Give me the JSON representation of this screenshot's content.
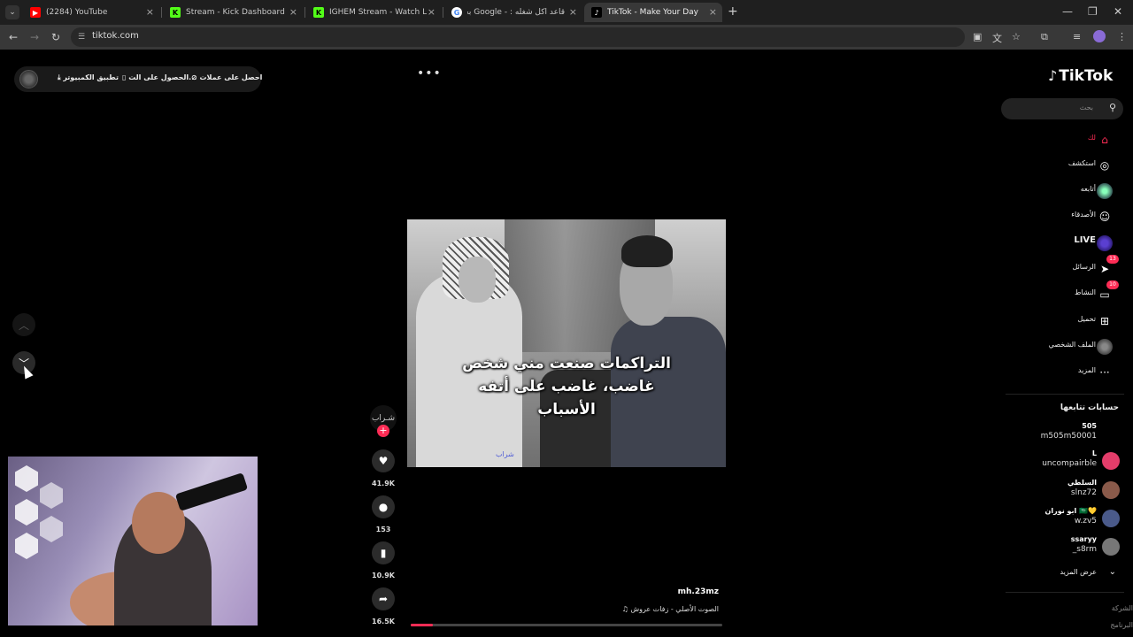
{
  "browser": {
    "tabs": [
      {
        "title": "(2284) YouTube",
        "favicon": "youtube-icon",
        "color": "#ff0000",
        "glyph": "▶"
      },
      {
        "title": "Stream - Kick Dashboard",
        "favicon": "kick-icon",
        "color": "#53fc18",
        "glyph": "K"
      },
      {
        "title": "IGHEM Stream - Watch Live on",
        "favicon": "kick-icon",
        "color": "#53fc18",
        "glyph": "K"
      },
      {
        "title": "قاعد اكل شغله : - Google بحث",
        "favicon": "google-icon",
        "color": "#ffffff",
        "glyph": "G"
      },
      {
        "title": "TikTok - Make Your Day",
        "favicon": "tiktok-icon",
        "color": "#000000",
        "glyph": "♪"
      }
    ],
    "active_tab": 4,
    "url": "tiktok.com"
  },
  "top_pill": {
    "get_coins": "احصل على عملات",
    "get_app": "الحصول على الت...",
    "desktop_app": "تطبيق الكمبيوتر"
  },
  "video": {
    "subtitle_lines": [
      "التراكمات صنعت مني شخص",
      "غاضب، غاضب على أتفه",
      "الأسباب"
    ],
    "watermark": "شراب",
    "creator_avatar_text": "شـراب",
    "handle": "mh.23mz",
    "music": "♫ الصوت الأصلي - زفات عروش",
    "progress": 0.07
  },
  "actions": {
    "likes": "41.9K",
    "comments": "153",
    "saves": "10.9K",
    "shares": "16.5K"
  },
  "sidebar": {
    "logo": "TikTok",
    "search_placeholder": "بحث",
    "items": [
      {
        "label": "لك",
        "icon": "home-icon",
        "glyph": "⌂",
        "active": true
      },
      {
        "label": "استكشف",
        "icon": "compass-icon",
        "glyph": "◎"
      },
      {
        "label": "أتابعه",
        "icon": "following-avatar-icon",
        "glyph": ""
      },
      {
        "label": "الأصدقاء",
        "icon": "friends-icon",
        "glyph": "☺"
      },
      {
        "label": "LIVE",
        "icon": "live-icon",
        "glyph": ""
      },
      {
        "label": "الرسائل",
        "icon": "messages-icon",
        "glyph": "➤",
        "badge": "13"
      },
      {
        "label": "النشاط",
        "icon": "activity-icon",
        "glyph": "▭",
        "badge": "10"
      },
      {
        "label": "تحميل",
        "icon": "upload-icon",
        "glyph": "⊞"
      },
      {
        "label": "الملف الشخصي",
        "icon": "profile-avatar-icon",
        "glyph": ""
      },
      {
        "label": "المزيد",
        "icon": "more-icon",
        "glyph": "···"
      }
    ],
    "following_title": "حسابات تتابعها",
    "accounts": [
      {
        "name": "505",
        "user": "m505m50001",
        "avatar_color": "#000000"
      },
      {
        "name": "L",
        "user": "uncompairble",
        "avatar_color": "#e33d6a"
      },
      {
        "name": "السلطي",
        "user": "slnz72",
        "avatar_color": "#8a5a4a"
      },
      {
        "name": "ابو نوران 🇸🇦💛",
        "user": "w.zv5",
        "avatar_color": "#4a5a8a"
      },
      {
        "name": "ssaryy",
        "user": "_s8rm",
        "avatar_color": "#777777"
      }
    ],
    "show_more": "عرض المزيد",
    "footer": [
      "الشركة",
      "البرنامج"
    ]
  },
  "colors": {
    "accent": "#fe2c55",
    "background": "#000000"
  }
}
